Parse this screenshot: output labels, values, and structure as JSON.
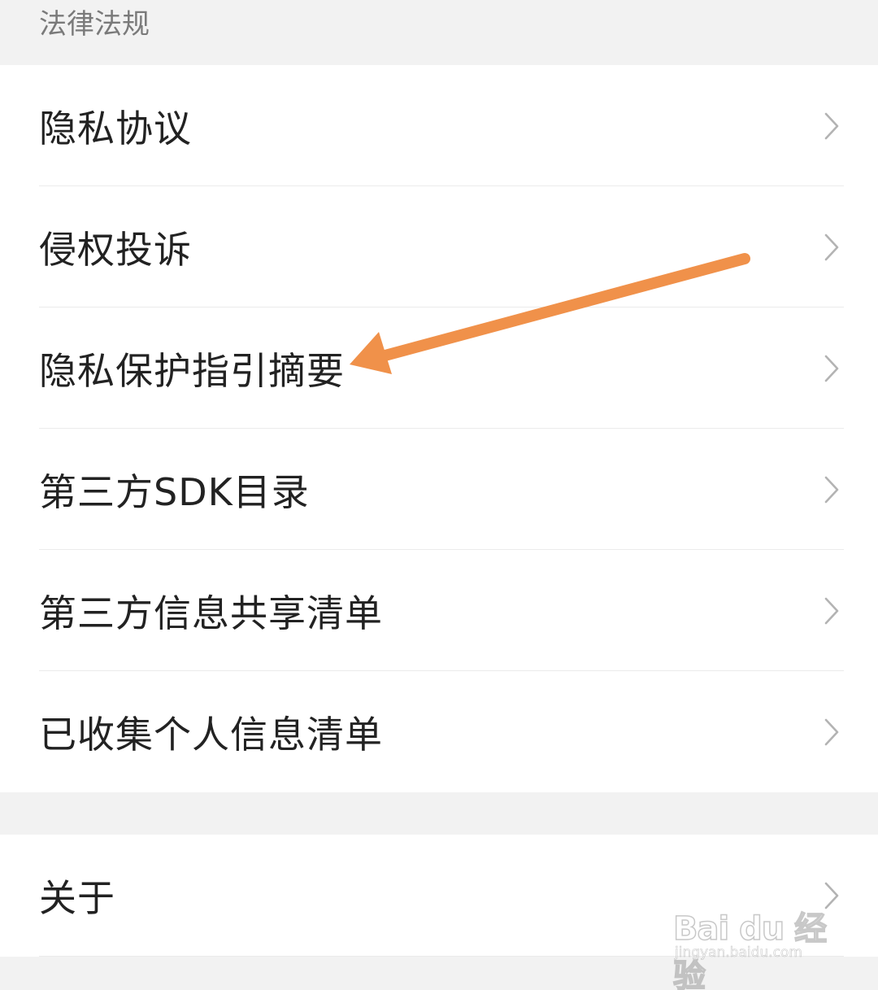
{
  "section_header": "法律法规",
  "legal_items": [
    {
      "label": "隐私协议",
      "icon": "chevron-right-icon"
    },
    {
      "label": "侵权投诉",
      "icon": "chevron-right-icon"
    },
    {
      "label": "隐私保护指引摘要",
      "icon": "chevron-right-icon"
    },
    {
      "label": "第三方SDK目录",
      "icon": "chevron-right-icon"
    },
    {
      "label": "第三方信息共享清单",
      "icon": "chevron-right-icon"
    },
    {
      "label": "已收集个人信息清单",
      "icon": "chevron-right-icon"
    }
  ],
  "about_item": {
    "label": "关于",
    "icon": "chevron-right-icon"
  },
  "annotation": {
    "color": "#f0914a",
    "points_to": "隐私保护指引摘要"
  },
  "watermark": {
    "logo": "Bai du 经验",
    "url": "jingyan.baidu.com"
  },
  "colors": {
    "background": "#f2f2f2",
    "card": "#ffffff",
    "text_primary": "#222222",
    "text_secondary": "#7a7a7a",
    "chevron": "#b3b3b3",
    "divider": "#ebebeb"
  }
}
